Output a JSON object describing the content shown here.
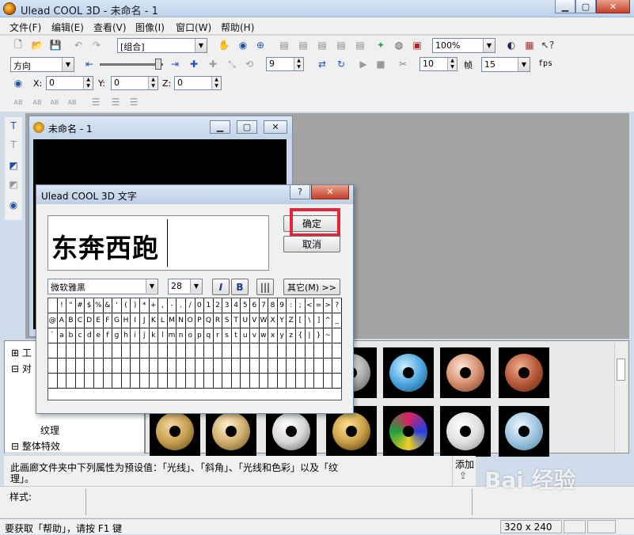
{
  "app": {
    "title": "Ulead COOL 3D - 未命名 - 1"
  },
  "menu": [
    "文件(F)",
    "编辑(E)",
    "查看(V)",
    "图像(I)",
    "窗口(W)",
    "帮助(H)"
  ],
  "toolbar": {
    "object_combo": "[组合]",
    "zoom_combo": "100%",
    "direction_combo": "方向",
    "frame_spin": "9",
    "frames_spin": "10",
    "frames_label": "帧",
    "fps_value": "15",
    "fps_label": "fps",
    "x_label": "X:",
    "x_value": "0",
    "y_label": "Y:",
    "y_value": "0",
    "z_label": "Z:",
    "z_value": "0",
    "text_align_icons": [
      "AB",
      "AB",
      "AB",
      "AB"
    ]
  },
  "document_window": {
    "title": "未命名 - 1"
  },
  "dialog": {
    "title": "Ulead COOL 3D 文字",
    "text_content": "东奔西跑",
    "ok_label": "确定",
    "cancel_label": "取消",
    "font_name": "微软雅黑",
    "font_size": "28",
    "italic_label": "I",
    "bold_label": "B",
    "more_label": "其它(M) >>",
    "help_label": "?",
    "charmap_rows": [
      [
        " ",
        "!",
        "\"",
        "#",
        "$",
        "%",
        "&",
        "'",
        "(",
        ")",
        "*",
        "+",
        ",",
        "-",
        ".",
        "/",
        "0",
        "1",
        "2",
        "3",
        "4",
        "5",
        "6",
        "7",
        "8",
        "9",
        ":",
        ";",
        "<",
        "=",
        ">",
        "?"
      ],
      [
        "@",
        "A",
        "B",
        "C",
        "D",
        "E",
        "F",
        "G",
        "H",
        "I",
        "J",
        "K",
        "L",
        "M",
        "N",
        "O",
        "P",
        "Q",
        "R",
        "S",
        "T",
        "U",
        "V",
        "W",
        "X",
        "Y",
        "Z",
        "[",
        "\\",
        "]",
        "^",
        "_"
      ],
      [
        "`",
        "a",
        "b",
        "c",
        "d",
        "e",
        "f",
        "g",
        "h",
        "i",
        "j",
        "k",
        "l",
        "m",
        "n",
        "o",
        "p",
        "q",
        "r",
        "s",
        "t",
        "u",
        "v",
        "w",
        "x",
        "y",
        "z",
        "{",
        "|",
        "}",
        "~",
        ""
      ]
    ]
  },
  "tree": {
    "items": [
      "工",
      "对",
      "纹理",
      "整体特效"
    ]
  },
  "gallery": {
    "thumb_colors": [
      "#b0b0b0",
      "#4fa8e0",
      "#d69070",
      "#b85a3a",
      "#c8a050",
      "#d0b070",
      "#d8d8d8",
      "#caa048",
      "#e02060",
      "#e0e0e0",
      "#9fc6e0"
    ]
  },
  "description": {
    "text_line1": "此画廊文件夹中下列属性为预设值：「光线」、「斜角」、「光线和色彩」以及「纹",
    "text_line2": "理」。",
    "add_label": "添加"
  },
  "style_label": "样式:",
  "status": {
    "help_text": "要获取「帮助」，请按 F1 键",
    "size_text": "320 x 240"
  },
  "watermark": "Bai 经验"
}
